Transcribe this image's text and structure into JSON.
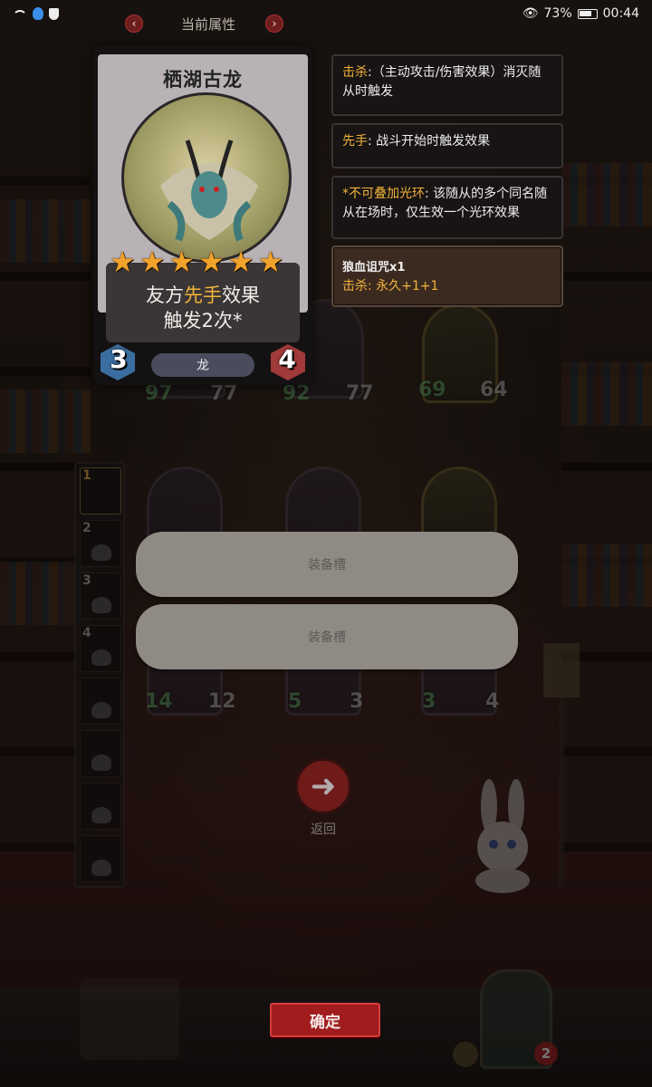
{
  "status_bar": {
    "battery": "73%",
    "time": "00:44"
  },
  "header": {
    "title": "当前属性",
    "prev": "‹",
    "next": "›"
  },
  "card": {
    "name": "栖湖古龙",
    "stars": [
      "★",
      "★",
      "★",
      "★",
      "★",
      "★"
    ],
    "effect_line1_prefix": "友方",
    "effect_line1_keyword": "先手",
    "effect_line1_suffix": "效果",
    "effect_line2": "触发2次*",
    "attack": "3",
    "health": "4",
    "tribe": "龙"
  },
  "tooltips": [
    {
      "keyword": "击杀",
      "text": ":（主动攻击/伤害效果）消灭随从时触发"
    },
    {
      "keyword": "先手",
      "text": ": 战斗开始时触发效果"
    },
    {
      "keyword": "*不可叠加光环",
      "text": ": 该随从的多个同名随从在场时，仅生效一个光环效果"
    }
  ],
  "buff_tooltip": {
    "title": "狼血诅咒x1",
    "keyword": "击杀",
    "text": ": 永久+1+1"
  },
  "board": {
    "row1_stats": [
      {
        "atk": "97",
        "hp": "77"
      },
      {
        "atk": "92",
        "hp": "77"
      },
      {
        "atk": "69",
        "hp": "64"
      }
    ],
    "row2_stats": [
      {
        "atk": "14",
        "hp": "12"
      },
      {
        "atk": "5",
        "hp": "3"
      },
      {
        "atk": "3",
        "hp": "4"
      }
    ]
  },
  "rail_slots": [
    "1",
    "2",
    "3",
    "4",
    "",
    "",
    "",
    ""
  ],
  "equip_slots": [
    "装备槽",
    "装备槽"
  ],
  "back_label": "返回",
  "back_icon": "arrow-left-icon",
  "confirm_label": "确定",
  "hero_badge": "2"
}
